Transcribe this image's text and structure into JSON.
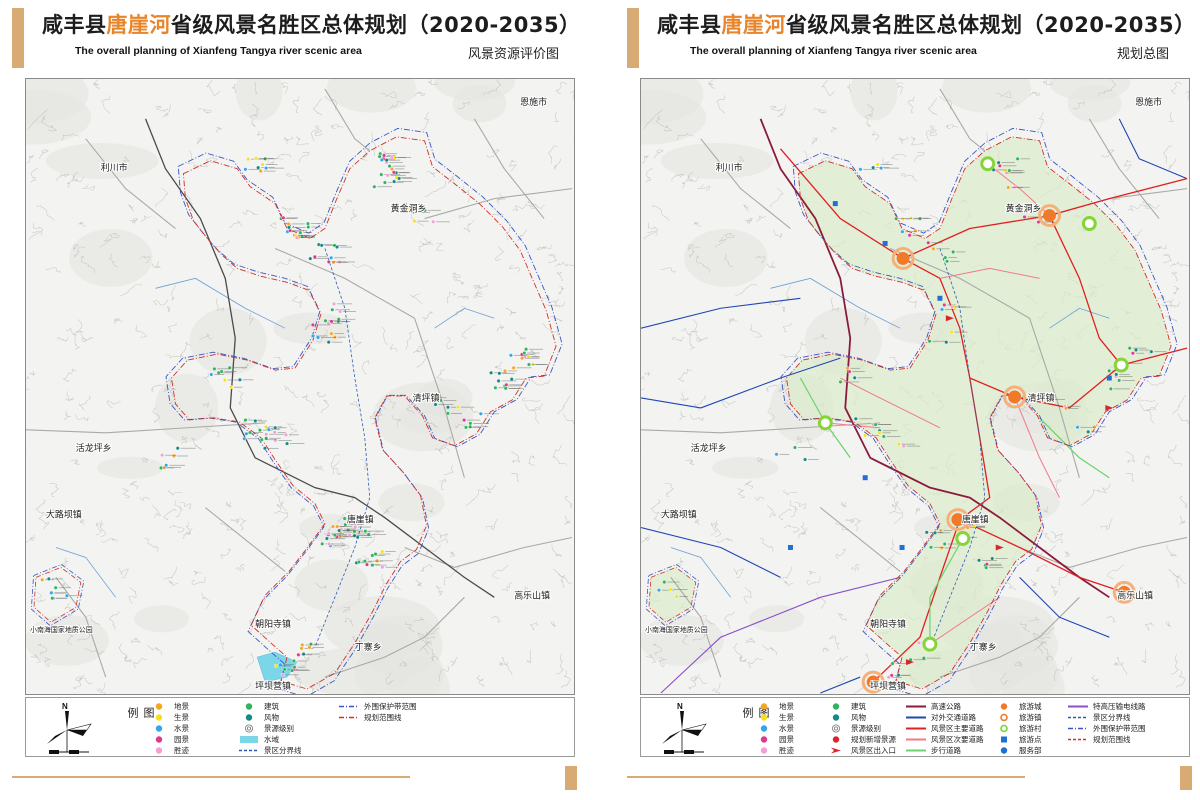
{
  "colors": {
    "accent": "#e8852a",
    "bar": "#d8ab74"
  },
  "left_panel": {
    "title_pre": "咸丰县",
    "title_hl": "唐崖河",
    "title_post": "省级风景名胜区总体规划（2020-2035）",
    "subtitle": "The overall planning of Xianfeng Tangya river scenic area",
    "map_label": "风景资源评价图",
    "legend": {
      "title": "图例",
      "north": "N",
      "columns": [
        [
          {
            "label": "地景",
            "symbol": "dot",
            "color": "#f5a623"
          },
          {
            "label": "生景",
            "symbol": "dot",
            "color": "#f3e21a"
          },
          {
            "label": "水景",
            "symbol": "dot",
            "color": "#35a7e6"
          },
          {
            "label": "园景",
            "symbol": "dot",
            "color": "#e0388f"
          },
          {
            "label": "胜迹",
            "symbol": "dot",
            "color": "#f2a0d4"
          }
        ],
        [
          {
            "label": "建筑",
            "symbol": "dot",
            "color": "#2fb35e"
          },
          {
            "label": "风物",
            "symbol": "dot",
            "color": "#138a86"
          },
          {
            "label": "景源级别",
            "symbol": "target",
            "color": "#777777"
          },
          {
            "label": "水域",
            "symbol": "rect",
            "color": "#7cd6ea"
          },
          {
            "label": "景区分界线",
            "symbol": "line-dash",
            "color": "#2a5db0"
          }
        ],
        [
          {
            "label": "外围保护带范围",
            "symbol": "line-dashdot",
            "color": "#3a55c4"
          },
          {
            "label": "规划范围线",
            "symbol": "line-dashdot",
            "color": "#d0302a"
          }
        ]
      ]
    }
  },
  "right_panel": {
    "title_pre": "咸丰县",
    "title_hl": "唐崖河",
    "title_post": "省级风景名胜区总体规划（2020-2035）",
    "subtitle": "The overall planning of Xianfeng Tangya river scenic area",
    "map_label": "规划总图",
    "legend": {
      "title": "图例",
      "north": "N",
      "columns": [
        [
          {
            "label": "地景",
            "symbol": "dot",
            "color": "#f5a623"
          },
          {
            "label": "生景",
            "symbol": "dot",
            "color": "#f3e21a"
          },
          {
            "label": "水景",
            "symbol": "dot",
            "color": "#35a7e6"
          },
          {
            "label": "园景",
            "symbol": "dot",
            "color": "#e0388f"
          },
          {
            "label": "胜迹",
            "symbol": "dot",
            "color": "#f2a0d4"
          }
        ],
        [
          {
            "label": "建筑",
            "symbol": "dot",
            "color": "#2fb35e"
          },
          {
            "label": "风物",
            "symbol": "dot",
            "color": "#138a86"
          },
          {
            "label": "景源级别",
            "symbol": "target",
            "color": "#777777"
          },
          {
            "label": "规划新增景源",
            "symbol": "dot",
            "color": "#d9262d"
          },
          {
            "label": "风景区出入口",
            "symbol": "arrow",
            "color": "#d9262d"
          }
        ],
        [
          {
            "label": "高速公路",
            "symbol": "line-solid",
            "color": "#8b1a3b"
          },
          {
            "label": "对外交通道路",
            "symbol": "line-solid",
            "color": "#2046b5"
          },
          {
            "label": "风景区主要道路",
            "symbol": "line-solid",
            "color": "#e02020"
          },
          {
            "label": "风景区次要道路",
            "symbol": "line-solid",
            "color": "#f07a8a"
          },
          {
            "label": "步行道路",
            "symbol": "line-solid",
            "color": "#6bd36b"
          }
        ],
        [
          {
            "label": "旅游城",
            "symbol": "dot",
            "color": "#f07a2a"
          },
          {
            "label": "旅游镇",
            "symbol": "ring",
            "color": "#f07a2a"
          },
          {
            "label": "旅游村",
            "symbol": "ring",
            "color": "#7cd23a"
          },
          {
            "label": "旅游点",
            "symbol": "square",
            "color": "#1f6fd6"
          },
          {
            "label": "服务部",
            "symbol": "dot",
            "color": "#1f6fd6"
          }
        ],
        [
          {
            "label": "特高压输电线路",
            "symbol": "line-solid",
            "color": "#8a4fc9"
          },
          {
            "label": "景区分界线",
            "symbol": "line-dash",
            "color": "#2a5db0"
          },
          {
            "label": "外围保护带范围",
            "symbol": "line-dashdot",
            "color": "#3a55c4"
          },
          {
            "label": "规划范围线",
            "symbol": "line-dash",
            "color": "#d0302a"
          }
        ]
      ]
    }
  },
  "map_labels": {
    "lichuan": "利川市",
    "enshi": "恩施市",
    "huangjindong": "黄金洞乡",
    "qingping": "清坪镇",
    "huolongping": "活龙坪乡",
    "dalouba": "大路坝镇",
    "tangya": "唐崖镇",
    "gaoleshan": "高乐山镇",
    "chaoyangsi": "朝阳寺镇",
    "dingzhai": "丁寨乡",
    "pingbaying": "坪坝营镇",
    "xiaonanhai": "小南海国家地质公园"
  }
}
